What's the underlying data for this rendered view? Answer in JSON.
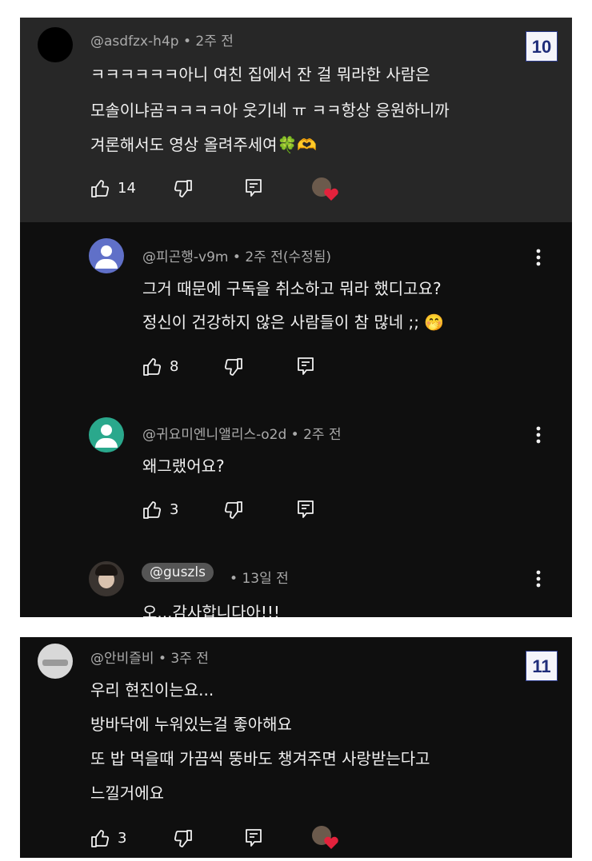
{
  "panel1": {
    "badge": "10",
    "comment": {
      "author": "@asdfzx-h4p",
      "time": "2주 전",
      "lines": [
        "ㅋㅋㅋㅋㅋㅋ아니 여친 집에서 잔 걸 뭐라한 사람은",
        "모솔이냐곰ㅋㅋㅋㅋ아 웃기네 ㅠ ㅋㅋ항상 응원하니까",
        "겨론해서도 영상 올려주세여🍀🫶"
      ],
      "likes": "14"
    },
    "replies": [
      {
        "author": "@피곤행-v9m",
        "time": "2주 전(수정됨)",
        "lines": [
          "그거 때문에 구독을 취소하고 뭐라 했디고요?",
          "정신이 건강하지 않은 사람들이 참 많네 ;; 🤭"
        ],
        "likes": "8",
        "avatar_color": "#6070c8"
      },
      {
        "author": "@귀요미엔니앨리스-o2d",
        "time": "2주 전",
        "lines": [
          "왜그랬어요?"
        ],
        "likes": "3",
        "avatar_color": "#2aa88c"
      },
      {
        "author": "@guszls",
        "time": "13일 전",
        "lines": [
          "오...감사합니다아!!!"
        ]
      }
    ]
  },
  "panel2": {
    "badge": "11",
    "comment": {
      "author": "@안비즐비",
      "time": "3주 전",
      "lines": [
        "우리 현진이는요...",
        "방바닥에 누워있는걸 좋아해요",
        "또 밥 먹을때 가끔씩 뚱바도 챙겨주면 사랑받는다고",
        "느낄거에요"
      ],
      "likes": "3"
    }
  },
  "colors": {
    "background": "#0f0f0f",
    "pinned_bg": "#272727",
    "meta": "#aaaaaa",
    "text": "#f1f1f1"
  },
  "icons": [
    "like-icon",
    "dislike-icon",
    "reply-icon",
    "creator-heart-icon",
    "more-vert-icon"
  ]
}
